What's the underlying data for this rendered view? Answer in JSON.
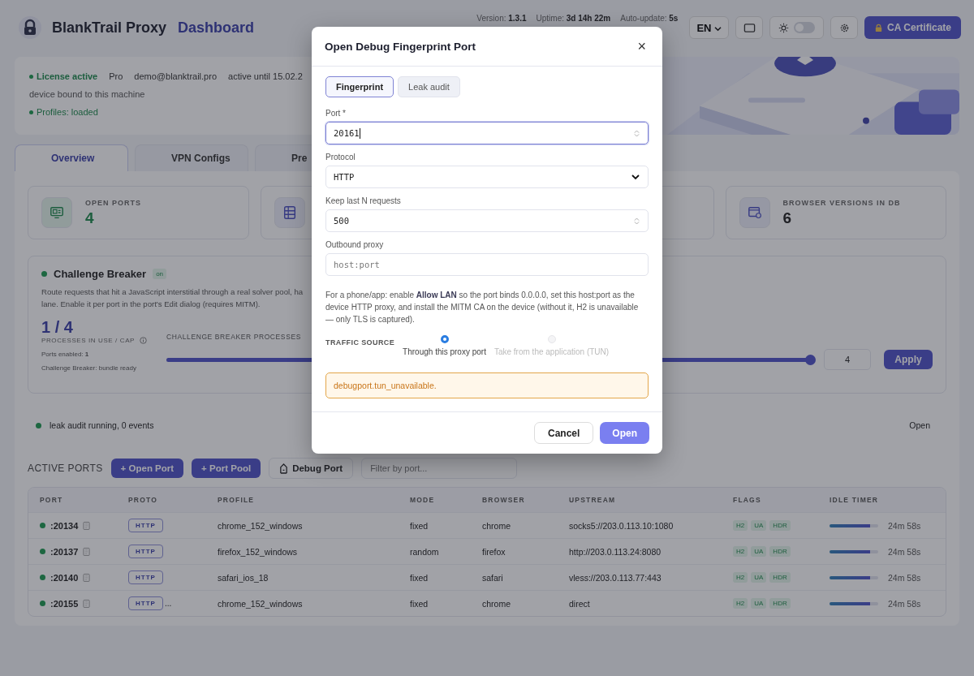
{
  "header": {
    "brand": "BlankTrail Proxy",
    "section": "Dashboard",
    "meta": [
      {
        "label": "Version:",
        "value": "1.3.1"
      },
      {
        "label": "Uptime:",
        "value": "3d 14h 22m"
      },
      {
        "label": "Auto-update:",
        "value": "5s"
      }
    ],
    "language": "EN",
    "theme_toggle": {
      "on": false
    },
    "ca_button": "CA Certificate"
  },
  "license": {
    "status": "License active",
    "plan": "Pro",
    "email": "demo@blanktrail.pro",
    "until": "active until 15.02.2",
    "device": "device bound to this machine",
    "profiles": "Profiles: loaded"
  },
  "tabs": [
    {
      "label": "Overview",
      "selected": true
    },
    {
      "label": "VPN Configs",
      "selected": false
    },
    {
      "label": "Pre",
      "selected": false
    }
  ],
  "stats": [
    {
      "kind": "ports",
      "label": "OPEN PORTS",
      "value": "4"
    },
    {
      "kind": "servers"
    },
    {
      "kind": "blank"
    },
    {
      "kind": "browser",
      "label": "BROWSER VERSIONS IN DB",
      "value": "6"
    }
  ],
  "challenge": {
    "title": "Challenge Breaker",
    "badge": "on",
    "lines": [
      "Route requests that hit a JavaScript interstitial through a real solver pool, ha",
      "lane. Enable it per port in the port's Edit dialog (requires MITM)."
    ],
    "usage": "1 / 4",
    "usage_caption": "PROCESSES IN USE / CAP",
    "ports_enabled": "Ports enabled: **1**",
    "bundle": "Challenge Breaker: bundle ready",
    "slider_label": "CHALLENGE BREAKER PROCESSES",
    "level": 1.0,
    "cap_value": "4",
    "apply": "Apply"
  },
  "leak_audit": {
    "status": "leak audit running, 0 events",
    "link": "Open"
  },
  "toolbar": {
    "title": "ACTIVE PORTS",
    "buttons": [
      {
        "kind": "primary",
        "label": "+ Open Port"
      },
      {
        "kind": "primary",
        "label": "+ Port Pool"
      },
      {
        "kind": "debug",
        "label": "Debug Port"
      }
    ],
    "filter_placeholder": "Filter by port..."
  },
  "table": {
    "columns": [
      "PORT",
      "PROTO",
      "PROFILE",
      "MODE",
      "BROWSER",
      "UPSTREAM",
      "FLAGS",
      "IDLE TIMER"
    ],
    "rows": [
      {
        "port": ":20134",
        "proto": "HTTP",
        "profile": "chrome_152_windows",
        "mode": "fixed",
        "browser": "chrome",
        "upstream": "socks5://203.0.113.10:1080",
        "flags": [
          "H2",
          "UA",
          "HDR"
        ],
        "level": 0.84,
        "timer": "24m 58s"
      },
      {
        "port": ":20137",
        "proto": "HTTP",
        "profile": "firefox_152_windows",
        "mode": "random",
        "browser": "firefox",
        "upstream": "http://203.0.113.24:8080",
        "flags": [
          "H2",
          "UA",
          "HDR"
        ],
        "level": 0.84,
        "timer": "24m 58s"
      },
      {
        "port": ":20140",
        "proto": "HTTP",
        "profile": "safari_ios_18",
        "mode": "fixed",
        "browser": "safari",
        "upstream": "vless://203.0.113.77:443",
        "flags": [
          "H2",
          "UA",
          "HDR"
        ],
        "level": 0.84,
        "timer": "24m 58s"
      },
      {
        "port": ":20155",
        "proto": "HTTP",
        "more": "...",
        "profile": "chrome_152_windows",
        "mode": "fixed",
        "browser": "chrome",
        "upstream": "direct",
        "flags": [
          "H2",
          "UA",
          "HDR"
        ],
        "level": 0.84,
        "timer": "24m 58s"
      }
    ]
  },
  "modal": {
    "title": "Open Debug Fingerprint Port",
    "close": "×",
    "tabs": [
      {
        "label": "Fingerprint",
        "selected": true
      },
      {
        "label": "Leak audit",
        "selected": false
      }
    ],
    "fields": [
      {
        "kind": "number",
        "label": "Port *",
        "value": "20161",
        "focused": true
      },
      {
        "kind": "select",
        "label": "Protocol",
        "value": "HTTP",
        "focused": false
      },
      {
        "kind": "number",
        "label": "Keep last N requests",
        "value": "500",
        "focused": false
      },
      {
        "kind": "text",
        "label": "Outbound proxy",
        "placeholder": "host:port",
        "focused": false
      }
    ],
    "note": "For a phone/app: enable **Allow LAN** so the port binds 0.0.0.0, set this host:port as the device HTTP proxy, and install the MITM CA on the device (without it, H2 is unavailable — only TLS is captured).",
    "traffic_label": "TRAFFIC SOURCE",
    "radios": [
      {
        "label": "Through this proxy port",
        "selected": true,
        "disabled": false
      },
      {
        "label": "Take from the application (TUN)",
        "selected": false,
        "disabled": true
      }
    ],
    "alert": "debugport.tun_unavailable.",
    "buttons": [
      {
        "kind": "secondary",
        "label": "Cancel"
      },
      {
        "kind": "primary",
        "label": "Open"
      }
    ]
  }
}
